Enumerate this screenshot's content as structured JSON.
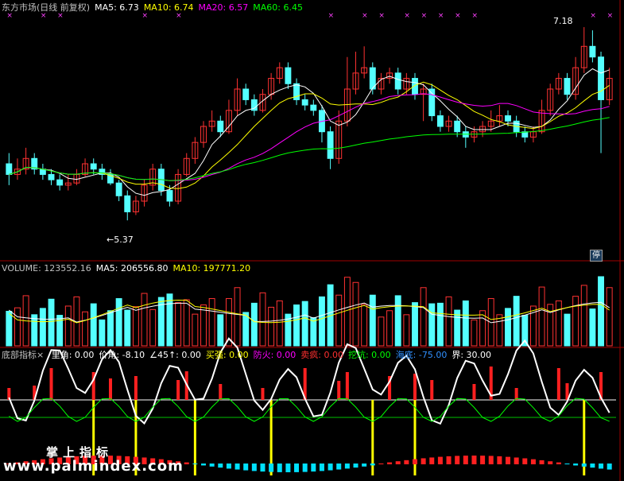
{
  "header_price": {
    "title": "东方市场(日线 前复权)",
    "ma5": "MA5: 6.73",
    "ma10": "MA10: 6.74",
    "ma20": "MA20: 6.57",
    "ma60": "MA60: 6.45",
    "colors": {
      "title": "#c0c0c0",
      "ma5": "#ffffff",
      "ma10": "#ffff00",
      "ma20": "#ff00ff",
      "ma60": "#00ff00"
    }
  },
  "header_volume": {
    "volume": "VOLUME: 123552.16",
    "ma5": "MA5: 206556.80",
    "ma10": "MA10: 197771.20"
  },
  "header_indicator": {
    "name": "底部指标",
    "close_mark": "×",
    "items": [
      {
        "text": "里角: 0.00",
        "color": "#ffffff"
      },
      {
        "text": "价角: -8.10",
        "color": "#ffffff"
      },
      {
        "text": "∠45↑: 0.00",
        "color": "#ffffff"
      },
      {
        "text": "买强: 0.00",
        "color": "#ffff00"
      },
      {
        "text": "防火: 0.00",
        "color": "#ff00ff"
      },
      {
        "text": "卖疯: 0.00",
        "color": "#ff3030"
      },
      {
        "text": "挖坑: 0.00",
        "color": "#00ff00"
      },
      {
        "text": "海底: -75.00",
        "color": "#3090ff"
      },
      {
        "text": "界: 30.00",
        "color": "#ffffff"
      }
    ]
  },
  "annotations": {
    "high_label": "7.18",
    "low_label": "5.37",
    "stop_badge": "停"
  },
  "watermark": {
    "line1": "掌上指标",
    "line2": "www.palmindex.com"
  },
  "chart_data": {
    "type": "candlestick",
    "y_range": [
      5.2,
      7.3
    ],
    "candles": [
      [
        5.9,
        5.8,
        6.0,
        5.7
      ],
      [
        5.8,
        5.85,
        5.95,
        5.75
      ],
      [
        5.85,
        5.95,
        6.05,
        5.8
      ],
      [
        5.95,
        5.85,
        6.0,
        5.8
      ],
      [
        5.85,
        5.8,
        5.9,
        5.75
      ],
      [
        5.8,
        5.75,
        5.85,
        5.7
      ],
      [
        5.75,
        5.7,
        5.8,
        5.65
      ],
      [
        5.7,
        5.72,
        5.8,
        5.65
      ],
      [
        5.72,
        5.8,
        5.85,
        5.7
      ],
      [
        5.8,
        5.9,
        5.95,
        5.78
      ],
      [
        5.9,
        5.85,
        5.95,
        5.8
      ],
      [
        5.85,
        5.8,
        5.9,
        5.75
      ],
      [
        5.8,
        5.72,
        5.85,
        5.7
      ],
      [
        5.72,
        5.6,
        5.75,
        5.55
      ],
      [
        5.6,
        5.45,
        5.65,
        5.37
      ],
      [
        5.45,
        5.55,
        5.6,
        5.42
      ],
      [
        5.55,
        5.7,
        5.75,
        5.5
      ],
      [
        5.7,
        5.85,
        5.9,
        5.65
      ],
      [
        5.85,
        5.65,
        5.9,
        5.6
      ],
      [
        5.65,
        5.55,
        5.7,
        5.5
      ],
      [
        5.55,
        5.8,
        5.85,
        5.52
      ],
      [
        5.8,
        5.95,
        6.0,
        5.78
      ],
      [
        5.95,
        6.1,
        6.15,
        5.9
      ],
      [
        6.1,
        6.25,
        6.3,
        6.05
      ],
      [
        6.25,
        6.3,
        6.4,
        6.2
      ],
      [
        6.3,
        6.2,
        6.35,
        6.15
      ],
      [
        6.2,
        6.4,
        6.5,
        6.18
      ],
      [
        6.4,
        6.6,
        6.7,
        6.35
      ],
      [
        6.6,
        6.5,
        6.65,
        6.45
      ],
      [
        6.5,
        6.4,
        6.55,
        6.35
      ],
      [
        6.4,
        6.55,
        6.6,
        6.38
      ],
      [
        6.55,
        6.7,
        6.75,
        6.5
      ],
      [
        6.7,
        6.8,
        6.85,
        6.65
      ],
      [
        6.8,
        6.65,
        6.85,
        6.6
      ],
      [
        6.65,
        6.5,
        6.7,
        6.45
      ],
      [
        6.5,
        6.45,
        6.55,
        6.4
      ],
      [
        6.45,
        6.4,
        6.5,
        6.35
      ],
      [
        6.4,
        6.2,
        6.45,
        6.1
      ],
      [
        6.2,
        5.95,
        6.25,
        5.85
      ],
      [
        5.95,
        6.3,
        6.4,
        5.9
      ],
      [
        6.3,
        6.6,
        6.9,
        6.25
      ],
      [
        6.6,
        6.75,
        6.95,
        6.55
      ],
      [
        6.75,
        6.8,
        7.0,
        6.7
      ],
      [
        6.8,
        6.6,
        6.85,
        6.55
      ],
      [
        6.6,
        6.7,
        6.75,
        6.55
      ],
      [
        6.7,
        6.75,
        6.8,
        6.65
      ],
      [
        6.75,
        6.6,
        6.8,
        6.55
      ],
      [
        6.6,
        6.7,
        6.75,
        6.55
      ],
      [
        6.7,
        6.55,
        6.75,
        6.5
      ],
      [
        6.55,
        6.6,
        6.65,
        6.3
      ],
      [
        6.6,
        6.35,
        6.65,
        6.3
      ],
      [
        6.35,
        6.25,
        6.4,
        6.2
      ],
      [
        6.25,
        6.3,
        6.35,
        6.2
      ],
      [
        6.3,
        6.2,
        6.35,
        6.15
      ],
      [
        6.2,
        6.15,
        6.25,
        6.05
      ],
      [
        6.15,
        6.2,
        6.25,
        6.1
      ],
      [
        6.2,
        6.25,
        6.3,
        6.15
      ],
      [
        6.25,
        6.3,
        6.4,
        6.2
      ],
      [
        6.3,
        6.35,
        6.45,
        6.25
      ],
      [
        6.35,
        6.3,
        6.4,
        6.25
      ],
      [
        6.3,
        6.2,
        6.35,
        6.15
      ],
      [
        6.2,
        6.15,
        6.25,
        6.1
      ],
      [
        6.15,
        6.2,
        6.25,
        6.1
      ],
      [
        6.2,
        6.4,
        6.5,
        6.18
      ],
      [
        6.4,
        6.6,
        6.65,
        6.35
      ],
      [
        6.6,
        6.7,
        6.75,
        6.55
      ],
      [
        6.7,
        6.55,
        6.75,
        6.5
      ],
      [
        6.55,
        6.8,
        6.9,
        6.5
      ],
      [
        6.8,
        7.0,
        7.18,
        6.75
      ],
      [
        7.0,
        6.9,
        7.15,
        6.85
      ],
      [
        6.9,
        6.5,
        6.95,
        6.0
      ],
      [
        6.5,
        6.7,
        6.8,
        6.45
      ]
    ],
    "volume": {
      "y_range": [
        0,
        1
      ]
    },
    "indicator": {
      "levels": {
        "upper": "界 30.00",
        "lower": "海底 -75.00"
      }
    }
  }
}
